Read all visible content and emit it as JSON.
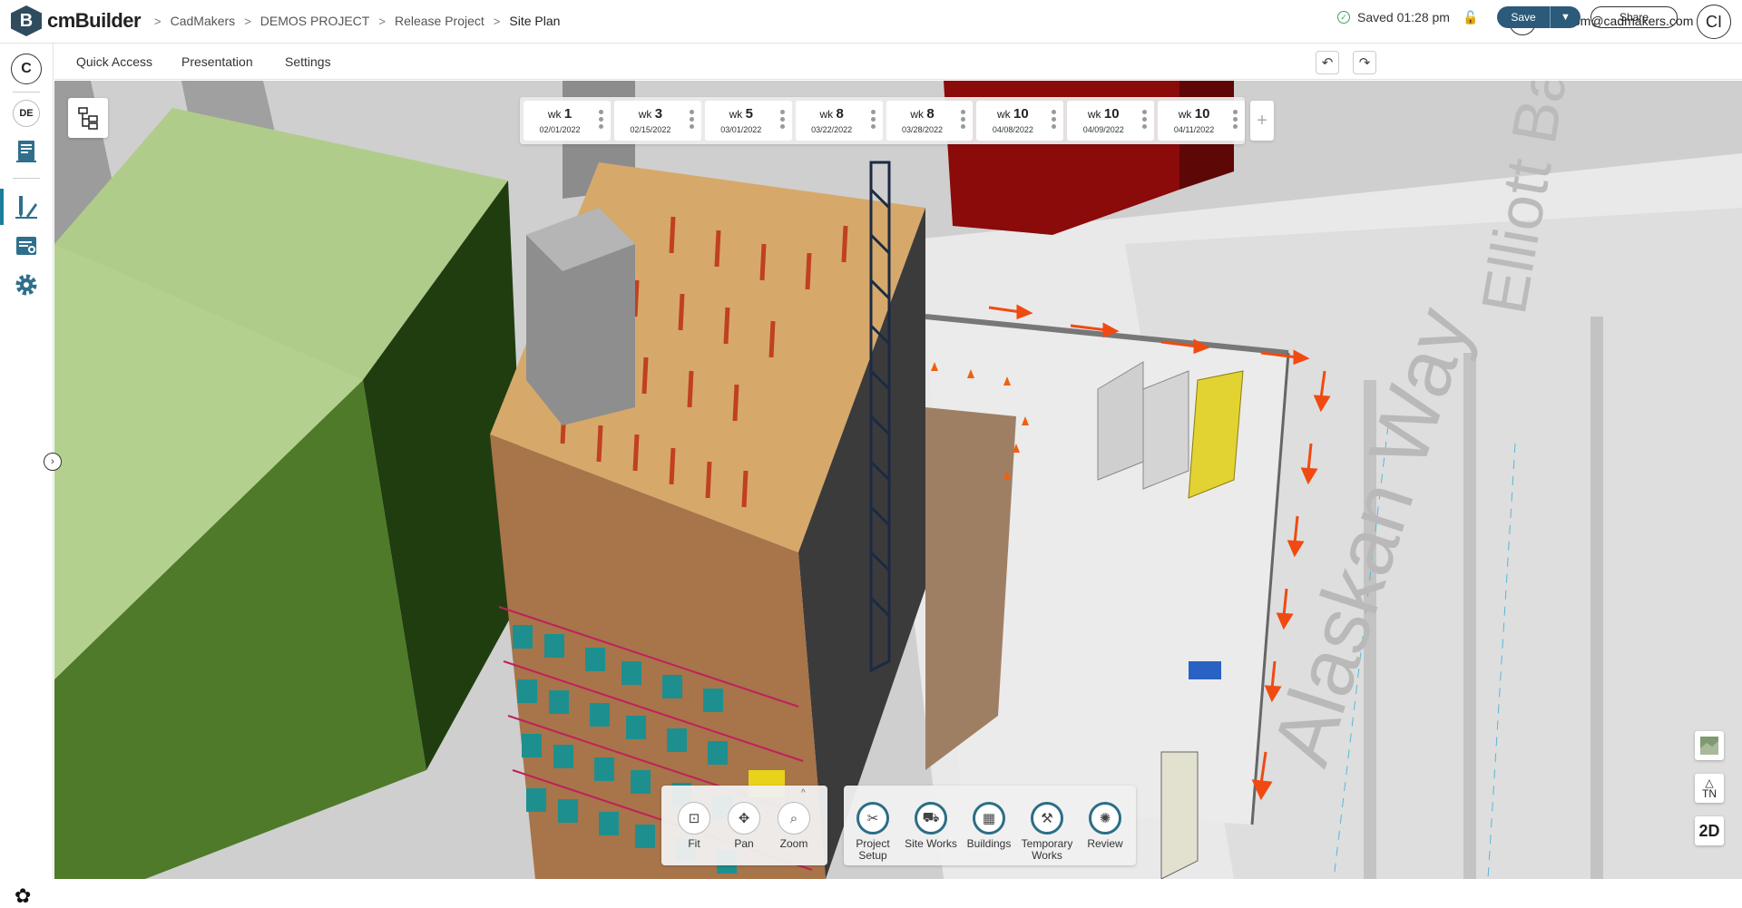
{
  "app": {
    "name": "cmBuilder",
    "logo_letter": "B"
  },
  "breadcrumb": [
    "CadMakers",
    "DEMOS PROJECT",
    "Release Project",
    "Site Plan"
  ],
  "header": {
    "help": "?",
    "user_email": "cibom@cadmakers.com",
    "avatar_initials": "CI"
  },
  "rail": {
    "company_initial": "C",
    "project_initials": "DE"
  },
  "menu": {
    "quick_access": "Quick Access",
    "presentation": "Presentation",
    "settings": "Settings"
  },
  "toolbar": {
    "saved_text": "Saved 01:28 pm",
    "save_label": "Save",
    "share_label": "Share"
  },
  "timeline": [
    {
      "prefix": "wk",
      "week": "1",
      "date": "02/01/2022"
    },
    {
      "prefix": "wk",
      "week": "3",
      "date": "02/15/2022"
    },
    {
      "prefix": "wk",
      "week": "5",
      "date": "03/01/2022"
    },
    {
      "prefix": "wk",
      "week": "8",
      "date": "03/22/2022"
    },
    {
      "prefix": "wk",
      "week": "8",
      "date": "03/28/2022"
    },
    {
      "prefix": "wk",
      "week": "10",
      "date": "04/08/2022"
    },
    {
      "prefix": "wk",
      "week": "10",
      "date": "04/09/2022"
    },
    {
      "prefix": "wk",
      "week": "10",
      "date": "04/11/2022"
    }
  ],
  "nav_tools": [
    {
      "label": "Fit",
      "icon": "fit-icon"
    },
    {
      "label": "Pan",
      "icon": "pan-icon"
    },
    {
      "label": "Zoom",
      "icon": "zoom-icon"
    }
  ],
  "main_tools": [
    {
      "label": "Project Setup",
      "icon": "project-setup-icon"
    },
    {
      "label": "Site Works",
      "icon": "site-works-icon"
    },
    {
      "label": "Buildings",
      "icon": "buildings-icon"
    },
    {
      "label": "Temporary Works",
      "icon": "temporary-works-icon"
    },
    {
      "label": "Review",
      "icon": "review-icon"
    }
  ],
  "map_labels": {
    "street_1": "Alaskan Way",
    "street_2": "Elliott Bay T"
  },
  "right_controls": {
    "north": "TN",
    "view_mode": "2D"
  },
  "colors": {
    "accent": "#2b5a7a",
    "tool_ring": "#2c6e86",
    "arrows": "#f04a12",
    "building_green": "#b0cc8a"
  }
}
